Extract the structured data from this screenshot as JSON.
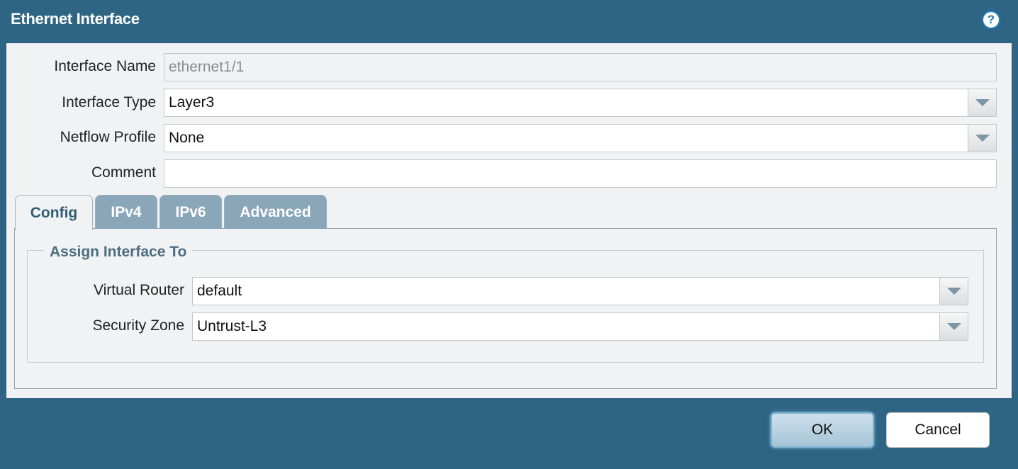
{
  "dialog": {
    "title": "Ethernet Interface",
    "help_icon": "?"
  },
  "form": {
    "interface_name": {
      "label": "Interface Name",
      "value": "ethernet1/1"
    },
    "interface_type": {
      "label": "Interface Type",
      "value": "Layer3"
    },
    "netflow_profile": {
      "label": "Netflow Profile",
      "value": "None"
    },
    "comment": {
      "label": "Comment",
      "value": ""
    }
  },
  "tabs": [
    {
      "label": "Config",
      "active": true
    },
    {
      "label": "IPv4",
      "active": false
    },
    {
      "label": "IPv6",
      "active": false
    },
    {
      "label": "Advanced",
      "active": false
    }
  ],
  "config": {
    "group_title": "Assign Interface To",
    "virtual_router": {
      "label": "Virtual Router",
      "value": "default"
    },
    "security_zone": {
      "label": "Security Zone",
      "value": "Untrust-L3"
    }
  },
  "buttons": {
    "ok": "OK",
    "cancel": "Cancel"
  },
  "icons": {
    "dropdown": "chevron-down-icon",
    "help": "help-icon"
  },
  "colors": {
    "header": "#2f6584",
    "panel": "#f1f2f3",
    "tab_inactive": "#8aa6b9"
  }
}
